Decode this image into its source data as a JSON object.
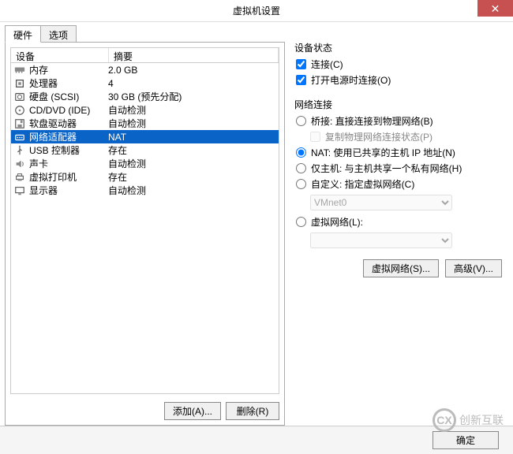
{
  "window": {
    "title": "虚拟机设置"
  },
  "tabs": {
    "hardware": "硬件",
    "options": "选项"
  },
  "columns": {
    "device": "设备",
    "summary": "摘要"
  },
  "devices": [
    {
      "id": "memory",
      "label": "内存",
      "summary": "2.0 GB",
      "icon": "memory"
    },
    {
      "id": "cpu",
      "label": "处理器",
      "summary": "4",
      "icon": "cpu"
    },
    {
      "id": "hdd",
      "label": "硬盘 (SCSI)",
      "summary": "30 GB (预先分配)",
      "icon": "hdd"
    },
    {
      "id": "cddvd",
      "label": "CD/DVD (IDE)",
      "summary": "自动检测",
      "icon": "cd"
    },
    {
      "id": "floppy",
      "label": "软盘驱动器",
      "summary": "自动检测",
      "icon": "floppy"
    },
    {
      "id": "netadapter",
      "label": "网络适配器",
      "summary": "NAT",
      "icon": "net",
      "selected": true
    },
    {
      "id": "usb",
      "label": "USB 控制器",
      "summary": "存在",
      "icon": "usb"
    },
    {
      "id": "sound",
      "label": "声卡",
      "summary": "自动检测",
      "icon": "sound"
    },
    {
      "id": "printer",
      "label": "虚拟打印机",
      "summary": "存在",
      "icon": "printer"
    },
    {
      "id": "display",
      "label": "显示器",
      "summary": "自动检测",
      "icon": "display"
    }
  ],
  "list_buttons": {
    "add": "添加(A)...",
    "remove": "删除(R)"
  },
  "device_status": {
    "title": "设备状态",
    "connected": "连接(C)",
    "connect_at_power_on": "打开电源时连接(O)"
  },
  "network": {
    "title": "网络连接",
    "bridged": "桥接: 直接连接到物理网络(B)",
    "replicate": "复制物理网络连接状态(P)",
    "nat": "NAT: 使用已共享的主机 IP 地址(N)",
    "hostonly": "仅主机: 与主机共享一个私有网络(H)",
    "custom": "自定义: 指定虚拟网络(C)",
    "custom_value": "VMnet0",
    "lan_segment": "虚拟网络(L):",
    "buttons": {
      "lan_segments": "虚拟网络(S)...",
      "advanced": "高级(V)..."
    }
  },
  "footer": {
    "ok": "确定"
  },
  "watermark": {
    "logo": "CX",
    "text": "创新互联"
  }
}
